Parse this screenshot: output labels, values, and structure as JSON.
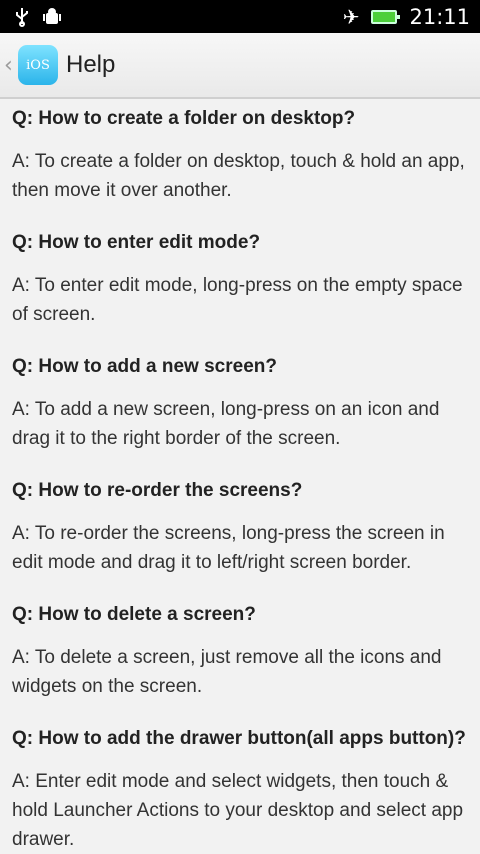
{
  "status": {
    "time": "21:11"
  },
  "actionbar": {
    "icon_label": "iOS",
    "title": "Help"
  },
  "faq": [
    {
      "q": "Q: How to create a folder on desktop?",
      "a": "A: To create a folder on desktop, touch & hold an app, then move it over another."
    },
    {
      "q": "Q: How to enter edit mode?",
      "a": "A: To enter edit mode, long-press on the empty space of screen."
    },
    {
      "q": "Q: How to add a new screen?",
      "a": "A: To add a new screen, long-press on an icon and drag it to the right border of the screen."
    },
    {
      "q": "Q: How to re-order the screens?",
      "a": "A: To re-order the screens, long-press the screen in edit mode and drag it to left/right screen border."
    },
    {
      "q": "Q: How to delete a screen?",
      "a": "A: To delete a screen, just remove all the icons and widgets on the screen."
    },
    {
      "q": "Q: How to add the drawer button(all apps button)?",
      "a": "A: Enter edit mode and select widgets, then touch & hold Launcher Actions to your desktop and select app drawer."
    }
  ]
}
